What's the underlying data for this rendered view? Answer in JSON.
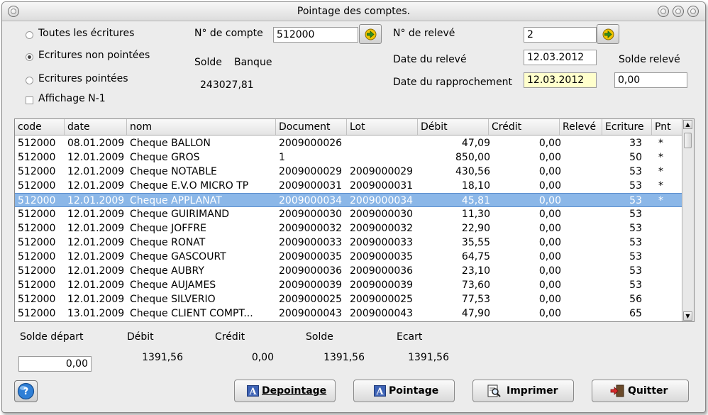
{
  "window": {
    "title": "Pointage des comptes."
  },
  "filters": {
    "all": "Toutes les écritures",
    "unchecked": "Ecritures non pointées",
    "checked": "Ecritures pointées",
    "prev_year": "Affichage N-1"
  },
  "account": {
    "label": "N° de compte",
    "value": "512000"
  },
  "bank": {
    "solde_label": "Solde",
    "banque_label": "Banque",
    "value": "243027,81"
  },
  "statement": {
    "num_label": "N° de relevé",
    "num_value": "2",
    "date_label": "Date du relevé",
    "date_value": "12.03.2012",
    "solde_label": "Solde relevé",
    "solde_value": "0,00",
    "rappro_label": "Date du rapprochement",
    "rappro_value": "12.03.2012"
  },
  "table": {
    "columns": [
      "code",
      "date",
      "nom",
      "Document",
      "Lot",
      "Débit",
      "Crédit",
      "Relevé",
      "Ecriture",
      "Pnt"
    ],
    "rows": [
      [
        "512000",
        "08.01.2009",
        "Cheque BALLON",
        "2009000026",
        "",
        "47,09",
        "0,00",
        "",
        "33",
        "*"
      ],
      [
        "512000",
        "12.01.2009",
        "Cheque GROS",
        "1",
        "",
        "850,00",
        "0,00",
        "",
        "50",
        "*"
      ],
      [
        "512000",
        "12.01.2009",
        "Cheque NOTABLE",
        "2009000029",
        "2009000029",
        "430,56",
        "0,00",
        "",
        "53",
        "*"
      ],
      [
        "512000",
        "12.01.2009",
        "Cheque E.V.O MICRO TP",
        "2009000031",
        "2009000031",
        "18,10",
        "0,00",
        "",
        "53",
        "*"
      ],
      [
        "512000",
        "12.01.2009",
        "Cheque APPLANAT",
        "2009000034",
        "2009000034",
        "45,81",
        "0,00",
        "",
        "53",
        "*"
      ],
      [
        "512000",
        "12.01.2009",
        "Cheque GUIRIMAND",
        "2009000030",
        "2009000030",
        "11,30",
        "0,00",
        "",
        "53",
        ""
      ],
      [
        "512000",
        "12.01.2009",
        "Cheque JOFFRE",
        "2009000032",
        "2009000032",
        "22,90",
        "0,00",
        "",
        "53",
        ""
      ],
      [
        "512000",
        "12.01.2009",
        "Cheque RONAT",
        "2009000033",
        "2009000033",
        "35,55",
        "0,00",
        "",
        "53",
        ""
      ],
      [
        "512000",
        "12.01.2009",
        "Cheque GASCOURT",
        "2009000035",
        "2009000035",
        "64,75",
        "0,00",
        "",
        "53",
        ""
      ],
      [
        "512000",
        "12.01.2009",
        "Cheque AUBRY",
        "2009000036",
        "2009000036",
        "23,10",
        "0,00",
        "",
        "53",
        ""
      ],
      [
        "512000",
        "12.01.2009",
        "Cheque AUJAMES",
        "2009000039",
        "2009000039",
        "73,60",
        "0,00",
        "",
        "53",
        ""
      ],
      [
        "512000",
        "12.01.2009",
        "Cheque SILVERIO",
        "2009000025",
        "2009000025",
        "77,53",
        "0,00",
        "",
        "56",
        ""
      ],
      [
        "512000",
        "13.01.2009",
        "Cheque CLIENT COMPT...",
        "2009000043",
        "2009000043",
        "47,90",
        "0,00",
        "",
        "65",
        ""
      ]
    ],
    "selected_row": 4
  },
  "summary": {
    "solde_depart_label": "Solde départ",
    "solde_depart_value": "0,00",
    "debit_label": "Débit",
    "debit_value": "1391,56",
    "credit_label": "Crédit",
    "credit_value": "0,00",
    "solde_label": "Solde",
    "solde_value": "1391,56",
    "ecart_label": "Ecart",
    "ecart_value": "1391,56"
  },
  "buttons": {
    "depointage": "Depointage",
    "pointage": "Pointage",
    "imprimer": "Imprimer",
    "quitter": "Quitter"
  },
  "colors": {
    "selection": "#8bb7e8",
    "highlight_field": "#ffffcc",
    "window_bg": "#ececec"
  }
}
